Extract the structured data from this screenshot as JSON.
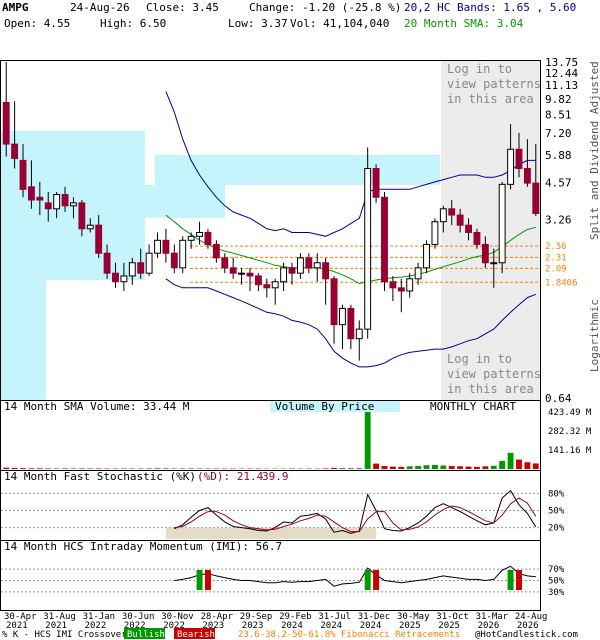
{
  "header": {
    "symbol": "AMPG",
    "date": "24-Aug-26",
    "close": "Close: 3.45",
    "change": "Change: -1.20 (-25.8 %)",
    "open": "Open: 4.55",
    "high": "High: 6.50",
    "low": "Low: 3.37",
    "vol": "Vol: 41,104,040",
    "bands": "20,2 HC Bands: 1.65 , 5.60",
    "sma": "20 Month SMA: 3.04"
  },
  "price_axis_ticks": [
    "13.75",
    "12.44",
    "11.13",
    "9.82",
    "8.51",
    "7.20",
    "5.88",
    "4.57",
    "3.26",
    "0.64"
  ],
  "price_side_label": "Split and Dividend Adjusted",
  "log_label": "Logarithmic",
  "fib_labels": [
    "2.56",
    "2.31",
    "2.09",
    "1.8406"
  ],
  "login_text": [
    "Log in to",
    "view patterns",
    "in this area"
  ],
  "volume": {
    "label": "14 Month SMA Volume: 33.44 M",
    "vbp": "Volume By Price",
    "monthly": "MONTHLY CHART",
    "ticks": [
      "423.49 M",
      "282.32 M",
      "141.16 M"
    ]
  },
  "stoch": {
    "label_prefix": "14 Month Fast Stochastic (%K)",
    "label_d": "(%D): 21.4",
    "value_d2": "39.9",
    "ticks": [
      "80%",
      "50%",
      "20%"
    ]
  },
  "imi": {
    "label": "14 Month HCS Intraday Momentum (IMI): 56.7",
    "ticks": [
      "70%",
      "50%",
      "30%"
    ]
  },
  "x_labels": [
    "30-Apr\n2021",
    "31-Aug\n2021",
    "31-Jan\n2022",
    "30-Jun\n2022",
    "30-Nov\n2022",
    "28-Apr\n2023",
    "29-Sep\n2023",
    "29-Feb\n2024",
    "31-Jul\n2024",
    "31-Dec\n2024",
    "30-May\n2025",
    "31-Oct\n2025",
    "31-Mar\n2026",
    "24-Aug\n2026"
  ],
  "footer": {
    "crossover": "% K - HCS IMI Crossover,",
    "bullish": "Bullish",
    "bearish": "Bearish",
    "fib": "23.6-38.2-50-61.8% Fibonacci Retracements",
    "copyright": "@HotCandlestick.com"
  },
  "colors": {
    "bull": "#ffffff",
    "bear": "#990033",
    "band": "#000099",
    "sma": "#009900",
    "vbp": "#c6f4fc",
    "fib": "#ff8000",
    "stochK": "#000000",
    "stochD": "#990033",
    "green_vol": "#009900",
    "red_vol": "#cc0000"
  },
  "chart_data": [
    {
      "type": "candlestick",
      "title": "AMPG",
      "ylim": [
        0.64,
        13.75
      ],
      "scale": "log",
      "x": [
        "May-21",
        "Jun-21",
        "Jul-21",
        "Aug-21",
        "Sep-21",
        "Oct-21",
        "Nov-21",
        "Dec-21",
        "Jan-22",
        "Feb-22",
        "Mar-22",
        "Apr-22",
        "May-22",
        "Jun-22",
        "Jul-22",
        "Aug-22",
        "Sep-22",
        "Oct-22",
        "Nov-22",
        "Dec-22",
        "Jan-23",
        "Feb-23",
        "Mar-23",
        "Apr-23",
        "May-23",
        "Jun-23",
        "Jul-23",
        "Aug-23",
        "Sep-23",
        "Oct-23",
        "Nov-23",
        "Dec-23",
        "Jan-24",
        "Feb-24",
        "Mar-24",
        "Apr-24",
        "May-24",
        "Jun-24",
        "Jul-24",
        "Aug-24",
        "Sep-24",
        "Oct-24",
        "Nov-24",
        "Dec-24",
        "Jan-25",
        "Feb-25",
        "Mar-25",
        "Apr-25",
        "May-25",
        "Jun-25",
        "Jul-25",
        "Aug-25",
        "Sep-25",
        "Oct-25",
        "Nov-25",
        "Dec-25",
        "Jan-26",
        "Feb-26",
        "Mar-26",
        "Apr-26",
        "May-26",
        "Jun-26",
        "Jul-26",
        "Aug-26"
      ],
      "open": [
        9.5,
        6.5,
        5.6,
        4.4,
        4.0,
        3.8,
        3.6,
        4.1,
        3.7,
        3.8,
        3.0,
        3.1,
        2.4,
        2.0,
        1.85,
        1.95,
        2.2,
        2.0,
        2.4,
        2.7,
        2.4,
        2.1,
        2.7,
        2.8,
        2.9,
        2.6,
        2.3,
        2.1,
        2.0,
        2.0,
        1.95,
        1.8,
        1.75,
        1.85,
        2.1,
        2.0,
        2.3,
        2.1,
        2.2,
        1.9,
        1.25,
        1.45,
        1.1,
        1.2,
        5.2,
        4.0,
        1.85,
        1.75,
        1.7,
        1.9,
        2.1,
        2.6,
        3.2,
        3.6,
        3.4,
        3.1,
        2.9,
        2.6,
        2.2,
        2.2,
        4.5,
        6.2,
        5.2,
        4.55
      ],
      "high": [
        13.75,
        9.6,
        6.5,
        5.6,
        4.6,
        4.2,
        4.2,
        4.4,
        4.0,
        3.9,
        3.3,
        3.4,
        2.6,
        2.2,
        2.2,
        2.3,
        2.5,
        2.6,
        2.9,
        3.0,
        2.6,
        2.8,
        2.9,
        3.2,
        3.0,
        2.7,
        2.4,
        2.3,
        2.1,
        2.1,
        2.0,
        1.9,
        1.9,
        2.2,
        2.2,
        2.4,
        2.4,
        2.4,
        2.3,
        1.95,
        1.5,
        1.5,
        1.3,
        6.3,
        5.4,
        4.2,
        1.95,
        1.9,
        2.0,
        2.2,
        2.7,
        3.3,
        3.7,
        3.9,
        3.6,
        3.3,
        3.0,
        2.8,
        2.5,
        4.6,
        7.8,
        7.2,
        6.8,
        6.5
      ],
      "low": [
        5.8,
        5.2,
        4.0,
        3.6,
        3.4,
        3.2,
        3.3,
        3.5,
        3.3,
        2.8,
        2.9,
        2.3,
        1.9,
        1.75,
        1.7,
        1.8,
        1.9,
        1.95,
        2.3,
        2.2,
        2.0,
        2.0,
        2.5,
        2.6,
        2.5,
        2.2,
        2.0,
        1.9,
        1.8,
        1.7,
        1.7,
        1.6,
        1.5,
        1.7,
        1.8,
        1.9,
        2.0,
        1.85,
        1.5,
        1.05,
        1.0,
        1.0,
        0.9,
        1.1,
        3.8,
        1.7,
        1.55,
        1.4,
        1.6,
        1.8,
        2.0,
        2.5,
        2.9,
        3.1,
        2.9,
        2.7,
        2.5,
        2.1,
        1.75,
        2.0,
        4.3,
        4.8,
        4.4,
        3.37
      ],
      "close": [
        6.5,
        5.7,
        4.3,
        3.9,
        3.9,
        3.6,
        4.1,
        3.7,
        3.8,
        3.0,
        3.1,
        2.4,
        2.0,
        1.85,
        1.95,
        2.2,
        2.0,
        2.4,
        2.7,
        2.4,
        2.1,
        2.7,
        2.8,
        2.9,
        2.6,
        2.3,
        2.1,
        2.0,
        2.0,
        1.95,
        1.8,
        1.75,
        1.85,
        2.1,
        2.0,
        2.3,
        2.1,
        2.2,
        1.9,
        1.25,
        1.45,
        1.1,
        1.2,
        5.2,
        4.0,
        1.85,
        1.75,
        1.7,
        1.9,
        2.1,
        2.6,
        3.2,
        3.6,
        3.4,
        3.1,
        2.9,
        2.6,
        2.2,
        2.2,
        4.5,
        6.2,
        5.2,
        4.55,
        3.45
      ],
      "band_upper": [
        null,
        null,
        null,
        null,
        null,
        null,
        null,
        null,
        null,
        null,
        null,
        null,
        null,
        null,
        null,
        null,
        null,
        null,
        null,
        10.5,
        8.7,
        6.8,
        5.6,
        4.9,
        4.4,
        4.0,
        3.7,
        3.5,
        3.4,
        3.3,
        3.15,
        3.0,
        2.95,
        3.0,
        2.9,
        2.9,
        2.9,
        2.85,
        2.8,
        2.9,
        3.0,
        3.15,
        3.3,
        4.2,
        4.3,
        4.3,
        4.3,
        4.3,
        4.3,
        4.4,
        4.5,
        4.6,
        4.7,
        4.8,
        4.9,
        4.9,
        4.9,
        4.8,
        4.8,
        4.9,
        5.1,
        5.4,
        5.6,
        5.6
      ],
      "band_lower": [
        null,
        null,
        null,
        null,
        null,
        null,
        null,
        null,
        null,
        null,
        null,
        null,
        null,
        null,
        null,
        null,
        null,
        null,
        null,
        1.9,
        1.8,
        1.75,
        1.75,
        1.75,
        1.75,
        1.7,
        1.65,
        1.6,
        1.55,
        1.5,
        1.45,
        1.4,
        1.38,
        1.35,
        1.3,
        1.28,
        1.25,
        1.2,
        1.1,
        0.98,
        0.92,
        0.88,
        0.85,
        0.85,
        0.86,
        0.88,
        0.92,
        0.95,
        0.97,
        0.98,
        0.99,
        1.0,
        1.0,
        1.02,
        1.05,
        1.08,
        1.1,
        1.15,
        1.2,
        1.3,
        1.4,
        1.5,
        1.6,
        1.65
      ],
      "sma20": [
        null,
        null,
        null,
        null,
        null,
        null,
        null,
        null,
        null,
        null,
        null,
        null,
        null,
        null,
        null,
        null,
        null,
        null,
        null,
        3.4,
        3.2,
        3.0,
        2.85,
        2.7,
        2.6,
        2.5,
        2.45,
        2.4,
        2.35,
        2.3,
        2.25,
        2.2,
        2.15,
        2.12,
        2.1,
        2.1,
        2.1,
        2.1,
        2.08,
        2.03,
        1.97,
        1.9,
        1.82,
        1.85,
        1.88,
        1.9,
        1.92,
        1.93,
        1.95,
        1.98,
        2.02,
        2.07,
        2.12,
        2.17,
        2.22,
        2.28,
        2.33,
        2.36,
        2.42,
        2.55,
        2.7,
        2.85,
        2.98,
        3.04
      ],
      "fibonacci": [
        2.56,
        2.31,
        2.09,
        1.8406
      ]
    },
    {
      "type": "bar",
      "title": "14 Month SMA Volume: 33.44 M",
      "ylim": [
        0,
        423.49
      ],
      "values": [
        10,
        8,
        6,
        5,
        5,
        4,
        4,
        4,
        4,
        4,
        4,
        4,
        3,
        3,
        4,
        4,
        3,
        4,
        5,
        4,
        3,
        4,
        4,
        4,
        3,
        3,
        3,
        3,
        3,
        3,
        3,
        2,
        3,
        3,
        3,
        3,
        3,
        3,
        4,
        8,
        6,
        5,
        6,
        423,
        40,
        22,
        18,
        16,
        20,
        22,
        28,
        30,
        26,
        22,
        20,
        18,
        16,
        20,
        24,
        60,
        120,
        70,
        50,
        41
      ]
    },
    {
      "type": "line",
      "title": "14 Month Fast Stochastic (%K)",
      "ylim": [
        0,
        100
      ],
      "series": [
        {
          "name": "(%K)",
          "values": [
            null,
            null,
            null,
            null,
            null,
            null,
            null,
            null,
            null,
            null,
            null,
            null,
            null,
            null,
            null,
            null,
            null,
            null,
            null,
            null,
            18,
            25,
            38,
            50,
            55,
            42,
            30,
            22,
            20,
            18,
            15,
            14,
            20,
            30,
            28,
            40,
            42,
            45,
            35,
            12,
            15,
            10,
            14,
            78,
            50,
            18,
            15,
            14,
            20,
            28,
            40,
            55,
            62,
            55,
            48,
            40,
            32,
            25,
            28,
            72,
            85,
            60,
            45,
            21.4
          ]
        },
        {
          "name": "(%D)",
          "values": [
            null,
            null,
            null,
            null,
            null,
            null,
            null,
            null,
            null,
            null,
            null,
            null,
            null,
            null,
            null,
            null,
            null,
            null,
            null,
            null,
            20,
            22,
            30,
            40,
            48,
            48,
            42,
            32,
            25,
            20,
            18,
            16,
            17,
            22,
            26,
            32,
            36,
            42,
            40,
            30,
            20,
            13,
            13,
            35,
            48,
            48,
            28,
            16,
            17,
            21,
            30,
            42,
            52,
            58,
            55,
            48,
            40,
            32,
            28,
            42,
            62,
            72,
            63,
            39.9
          ]
        }
      ]
    },
    {
      "type": "line",
      "title": "14 Month HCS Intraday Momentum (IMI): 56.7",
      "ylim": [
        0,
        100
      ],
      "series": [
        {
          "name": "IMI",
          "values": [
            null,
            null,
            null,
            null,
            null,
            null,
            null,
            null,
            null,
            null,
            null,
            null,
            null,
            null,
            null,
            null,
            null,
            null,
            null,
            null,
            50,
            52,
            55,
            60,
            62,
            58,
            55,
            52,
            50,
            50,
            48,
            46,
            46,
            48,
            47,
            48,
            48,
            50,
            52,
            40,
            44,
            45,
            47,
            72,
            60,
            50,
            48,
            46,
            48,
            50,
            52,
            55,
            58,
            56,
            54,
            52,
            52,
            50,
            52,
            68,
            75,
            62,
            58,
            56.7
          ]
        }
      ]
    }
  ]
}
